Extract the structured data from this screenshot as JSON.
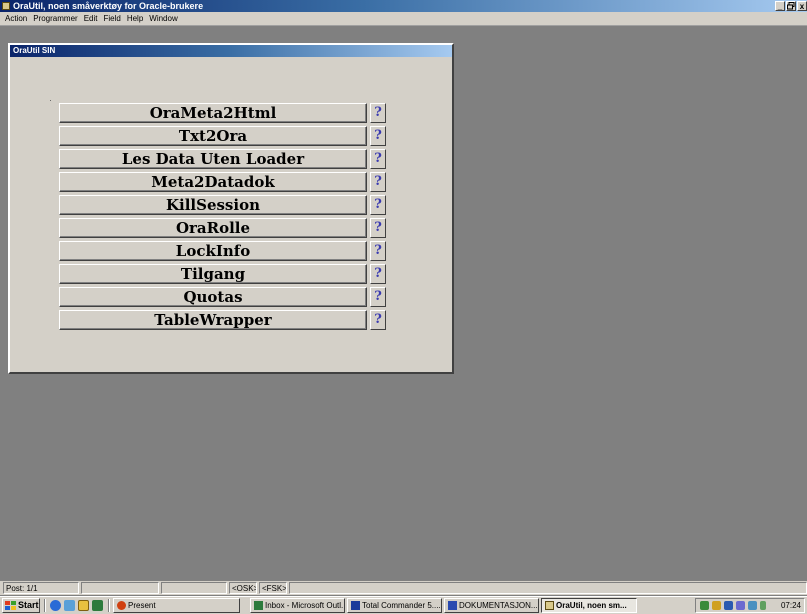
{
  "app": {
    "title": "OraUtil, noen småverktøy for Oracle-brukere",
    "window_controls": [
      "_",
      "̵",
      "x"
    ],
    "icon": "oracle-forms-icon"
  },
  "menu": [
    "Action",
    "Programmer",
    "Edit",
    "Field",
    "Help",
    "Window"
  ],
  "child_window": {
    "title": "OraUtil SIN",
    "buttons": [
      {
        "label": "OraMeta2Html",
        "help": "?"
      },
      {
        "label": "Txt2Ora",
        "help": "?"
      },
      {
        "label": "Les Data Uten Loader",
        "help": "?"
      },
      {
        "label": "Meta2Datadok",
        "help": "?"
      },
      {
        "label": "KillSession",
        "help": "?"
      },
      {
        "label": "OraRolle",
        "help": "?"
      },
      {
        "label": "LockInfo",
        "help": "?"
      },
      {
        "label": "Tilgang",
        "help": "?"
      },
      {
        "label": "Quotas",
        "help": "?"
      },
      {
        "label": "TableWrapper",
        "help": "?"
      }
    ]
  },
  "statusbar": {
    "record": "Post: 1/1",
    "osk": "<OSK>",
    "fsk": "<FSK>"
  },
  "taskbar": {
    "start_label": "Start",
    "quick_launch": [
      "internet-explorer-icon",
      "desktop-icon",
      "outlook-express-icon",
      "outlook-icon"
    ],
    "tasks": [
      {
        "label": "Present",
        "icon": "powerpoint-icon",
        "active": false
      },
      {
        "label": "Inbox - Microsoft Outl...",
        "icon": "outlook-icon",
        "active": false
      },
      {
        "label": "Total Commander 5....",
        "icon": "total-commander-icon",
        "active": false
      },
      {
        "label": "DOKUMENTASJON...",
        "icon": "word-icon",
        "active": false
      },
      {
        "label": "OraUtil, noen sm...",
        "icon": "oracle-forms-icon",
        "active": true
      }
    ],
    "clock": "07:24"
  },
  "colors": {
    "title_gradient_start": "#0a246a",
    "title_gradient_end": "#a6caf0",
    "face": "#d4d0c8",
    "mdi_background": "#808080",
    "help_glyph": "#3a3ab0"
  }
}
